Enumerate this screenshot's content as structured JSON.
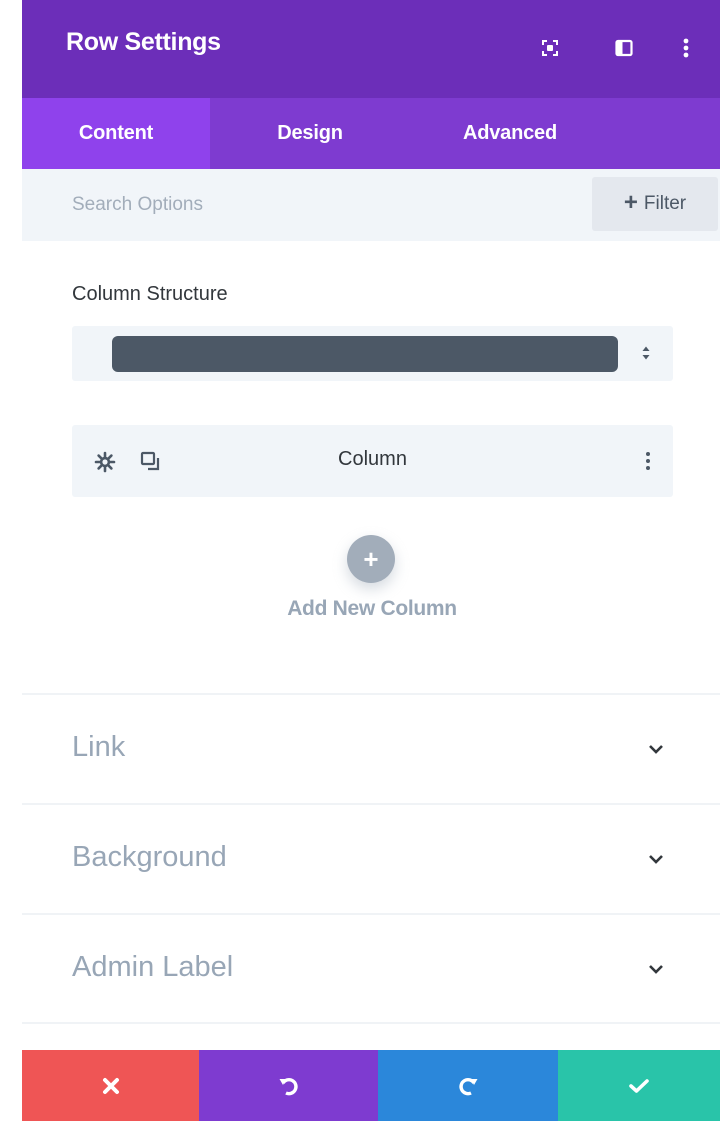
{
  "header": {
    "title": "Row Settings",
    "icons": [
      "expand-icon",
      "split-view-icon",
      "more-vertical-icon"
    ]
  },
  "tabs": [
    {
      "label": "Content",
      "active": true
    },
    {
      "label": "Design",
      "active": false
    },
    {
      "label": "Advanced",
      "active": false
    }
  ],
  "search": {
    "placeholder": "Search Options",
    "filter_label": "Filter"
  },
  "column_structure": {
    "label": "Column Structure"
  },
  "column_item": {
    "label": "Column",
    "icons": [
      "gear-icon",
      "duplicate-icon",
      "more-vertical-icon"
    ]
  },
  "add_column": {
    "label": "Add New Column"
  },
  "toggles": [
    {
      "label": "Link"
    },
    {
      "label": "Background"
    },
    {
      "label": "Admin Label"
    }
  ],
  "footer": {
    "buttons": [
      "close-icon",
      "undo-icon",
      "redo-icon",
      "check-icon"
    ]
  },
  "colors": {
    "header": "#6c2eb9",
    "tabs": "#7e3bd0",
    "tab_active": "#8f42ec",
    "close": "#ef5555",
    "undo": "#7e3bd0",
    "redo": "#2b87da",
    "save": "#29c4a9"
  }
}
